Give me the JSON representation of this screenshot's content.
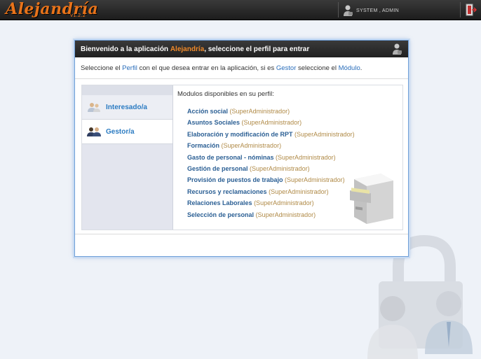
{
  "app": {
    "logo_text": "Alejandría",
    "version": "v1.2.2"
  },
  "topbar": {
    "user_label": "SYSTEM , ADMIN",
    "user_icon": "user-lock-icon",
    "exit_icon": "exit-door-icon"
  },
  "dialog": {
    "title_prefix": "Bienvenido a la aplicación ",
    "title_app": "Alejandría",
    "title_suffix": ", seleccione el perfil para entrar",
    "subtitle_1": "Seleccione el ",
    "subtitle_link_1": "Perfil",
    "subtitle_2": " con el que desea entrar en la aplicación, si es ",
    "subtitle_link_2": "Gestor",
    "subtitle_3": " seleccione el ",
    "subtitle_link_3": "Módulo",
    "subtitle_4": "."
  },
  "profiles": [
    {
      "label": "Interesado/a",
      "icon": "users-icon"
    },
    {
      "label": "Gestor/a",
      "icon": "manager-icon"
    }
  ],
  "modules": {
    "title": "Modulos disponibles en su perfil:",
    "items": [
      {
        "name": "Acción social",
        "role": "(SuperAdministrador)"
      },
      {
        "name": "Asuntos Sociales",
        "role": "(SuperAdministrador)"
      },
      {
        "name": "Elaboración y modificación de RPT",
        "role": "(SuperAdministrador)"
      },
      {
        "name": "Formación",
        "role": "(SuperAdministrador)"
      },
      {
        "name": "Gasto de personal - nóminas",
        "role": "(SuperAdministrador)"
      },
      {
        "name": "Gestión de personal",
        "role": "(SuperAdministrador)"
      },
      {
        "name": "Provisión de puestos de trabajo",
        "role": "(SuperAdministrador)"
      },
      {
        "name": "Recursos y reclamaciones",
        "role": "(SuperAdministrador)"
      },
      {
        "name": "Relaciones Laborales",
        "role": "(SuperAdministrador)"
      },
      {
        "name": "Selección de personal",
        "role": "(SuperAdministrador)"
      }
    ]
  },
  "colors": {
    "accent": "#e8731a",
    "link": "#2b7bc2",
    "role_text": "#b08a47"
  }
}
